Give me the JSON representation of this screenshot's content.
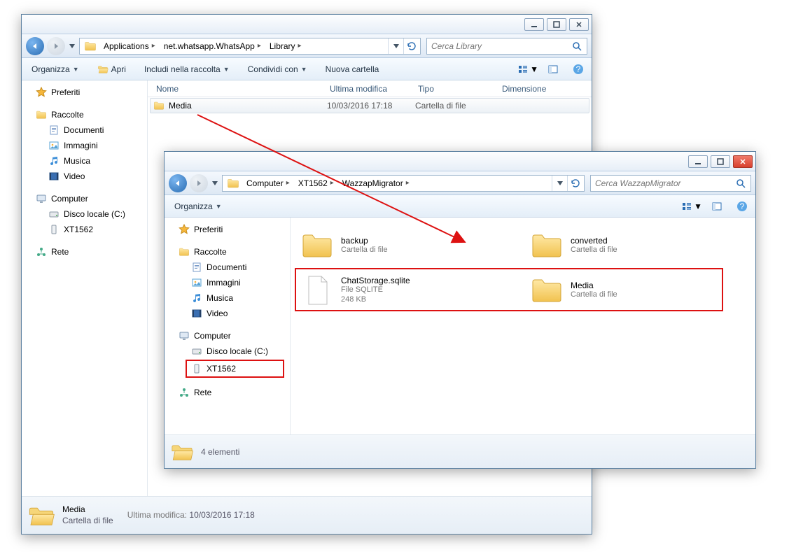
{
  "w1": {
    "breadcrumbs": [
      "Applications",
      "net.whatsapp.WhatsApp",
      "Library"
    ],
    "search_placeholder": "Cerca Library",
    "toolbar": {
      "organize": "Organizza",
      "open": "Apri",
      "include": "Includi nella raccolta",
      "share": "Condividi con",
      "newfolder": "Nuova cartella"
    },
    "columns": {
      "name": "Nome",
      "date": "Ultima modifica",
      "type": "Tipo",
      "size": "Dimensione"
    },
    "rows": [
      {
        "name": "Media",
        "date": "10/03/2016 17:18",
        "type": "Cartella di file"
      }
    ],
    "sidebar": {
      "favorites": "Preferiti",
      "libraries": "Raccolte",
      "lib_items": [
        "Documenti",
        "Immagini",
        "Musica",
        "Video"
      ],
      "computer": "Computer",
      "comp_items": [
        "Disco locale (C:)",
        "XT1562"
      ],
      "network": "Rete"
    },
    "status": {
      "title": "Media",
      "sub": "Cartella di file",
      "date_label": "Ultima modifica:",
      "date": "10/03/2016 17:18"
    }
  },
  "w2": {
    "breadcrumbs": [
      "Computer",
      "XT1562",
      "WazzapMigrator"
    ],
    "search_placeholder": "Cerca WazzapMigrator",
    "toolbar": {
      "organize": "Organizza"
    },
    "tiles": [
      {
        "title": "backup",
        "sub": "Cartella di file",
        "kind": "folder"
      },
      {
        "title": "converted",
        "sub": "Cartella di file",
        "kind": "folder"
      },
      {
        "title": "ChatStorage.sqlite",
        "sub": "File SQLITE\n248 KB",
        "kind": "file"
      },
      {
        "title": "Media",
        "sub": "Cartella di file",
        "kind": "folder"
      }
    ],
    "sidebar": {
      "favorites": "Preferiti",
      "libraries": "Raccolte",
      "lib_items": [
        "Documenti",
        "Immagini",
        "Musica",
        "Video"
      ],
      "computer": "Computer",
      "comp_items": [
        "Disco locale (C:)",
        "XT1562"
      ],
      "network": "Rete"
    },
    "status": {
      "count": "4 elementi"
    }
  }
}
